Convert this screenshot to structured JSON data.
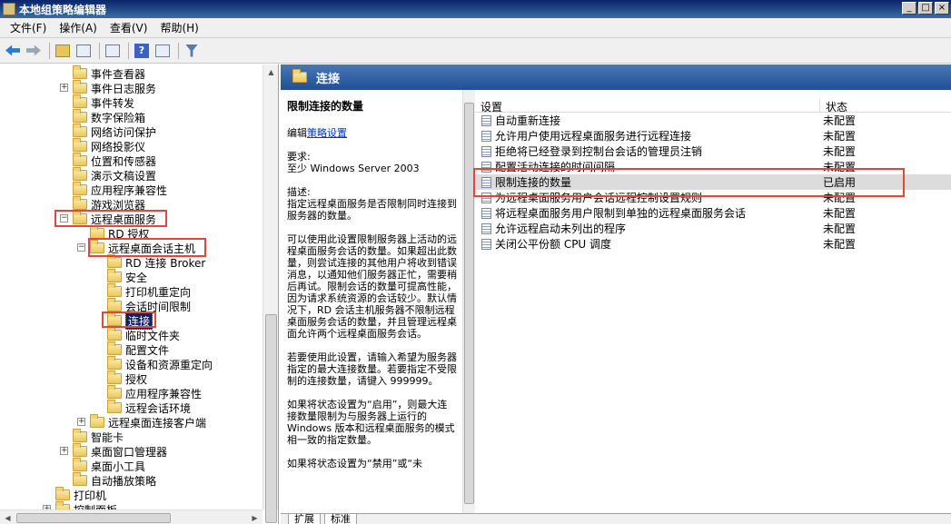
{
  "window": {
    "title": "本地组策略编辑器",
    "buttons": [
      "_",
      "□",
      "×"
    ]
  },
  "menu": [
    "文件(F)",
    "操作(A)",
    "查看(V)",
    "帮助(H)"
  ],
  "toolbar": [
    "back-icon",
    "forward-icon",
    "up-icon",
    "show-hide-tree-icon",
    "export-icon",
    "help-icon",
    "properties-icon",
    "filter-icon"
  ],
  "tree": [
    {
      "label": "事件查看器",
      "expander": ""
    },
    {
      "label": "事件日志服务",
      "expander": "+"
    },
    {
      "label": "事件转发",
      "expander": ""
    },
    {
      "label": "数字保险箱",
      "expander": ""
    },
    {
      "label": "网络访问保护",
      "expander": ""
    },
    {
      "label": "网络投影仪",
      "expander": ""
    },
    {
      "label": "位置和传感器",
      "expander": ""
    },
    {
      "label": "演示文稿设置",
      "expander": ""
    },
    {
      "label": "应用程序兼容性",
      "expander": ""
    },
    {
      "label": "游戏浏览器",
      "expander": ""
    },
    {
      "label": "远程桌面服务",
      "expander": "−"
    },
    {
      "label": "RD 授权",
      "expander": ""
    },
    {
      "label": "远程桌面会话主机",
      "expander": "−"
    },
    {
      "label": "RD 连接 Broker",
      "expander": ""
    },
    {
      "label": "安全",
      "expander": ""
    },
    {
      "label": "打印机重定向",
      "expander": ""
    },
    {
      "label": "会话时间限制",
      "expander": ""
    },
    {
      "label": "连接",
      "expander": ""
    },
    {
      "label": "临时文件夹",
      "expander": ""
    },
    {
      "label": "配置文件",
      "expander": ""
    },
    {
      "label": "设备和资源重定向",
      "expander": ""
    },
    {
      "label": "授权",
      "expander": ""
    },
    {
      "label": "应用程序兼容性",
      "expander": ""
    },
    {
      "label": "远程会话环境",
      "expander": ""
    },
    {
      "label": "远程桌面连接客户端",
      "expander": "+"
    },
    {
      "label": "智能卡",
      "expander": ""
    },
    {
      "label": "桌面窗口管理器",
      "expander": "+"
    },
    {
      "label": "桌面小工具",
      "expander": ""
    },
    {
      "label": "自动播放策略",
      "expander": ""
    },
    {
      "label": "打印机",
      "expander": ""
    },
    {
      "label": "控制面板",
      "expander": "+"
    }
  ],
  "header": {
    "title": "连接"
  },
  "description": {
    "title": "限制连接的数量",
    "edit_prefix": "编辑",
    "edit_link": "策略设置",
    "req_label": "要求:",
    "req_value": "至少 Windows Server 2003",
    "desc_label": "描述:",
    "p1": "指定远程桌面服务是否限制同时连接到服务器的数量。",
    "p2": "可以使用此设置限制服务器上活动的远程桌面服务会话的数量。如果超出此数量，则尝试连接的其他用户将收到错误消息，以通知他们服务器正忙，需要稍后再试。限制会话的数量可提高性能，因为请求系统资源的会话较少。默认情况下，RD 会话主机服务器不限制远程桌面服务会话的数量，并且管理远程桌面允许两个远程桌面服务会话。",
    "p3": "若要使用此设置，请输入希望为服务器指定的最大连接数量。若要指定不受限制的连接数量，请键入 999999。",
    "p4": "如果将状态设置为“启用”，则最大连接数量限制为与服务器上运行的 Windows 版本和远程桌面服务的模式相一致的指定数量。",
    "p5": "如果将状态设置为“禁用”或“未"
  },
  "list": {
    "col_setting": "设置",
    "col_state": "状态",
    "rows": [
      {
        "name": "自动重新连接",
        "state": "未配置"
      },
      {
        "name": "允许用户使用远程桌面服务进行远程连接",
        "state": "未配置"
      },
      {
        "name": "拒绝将已经登录到控制台会话的管理员注销",
        "state": "未配置"
      },
      {
        "name": "配置活动连接的时间间隔",
        "state": "未配置"
      },
      {
        "name": "限制连接的数量",
        "state": "已启用"
      },
      {
        "name": "为远程桌面服务用户会话远程控制设置规则",
        "state": "未配置"
      },
      {
        "name": "将远程桌面服务用户限制到单独的远程桌面服务会话",
        "state": "未配置"
      },
      {
        "name": "允许远程启动未列出的程序",
        "state": "未配置"
      },
      {
        "name": "关闭公平份额 CPU 调度",
        "state": "未配置"
      }
    ]
  },
  "tabs": [
    "扩展",
    "标准"
  ],
  "colors": {
    "highlight_box": "#e3463a",
    "selected": "#0a246a",
    "header": "#1f4f95"
  }
}
